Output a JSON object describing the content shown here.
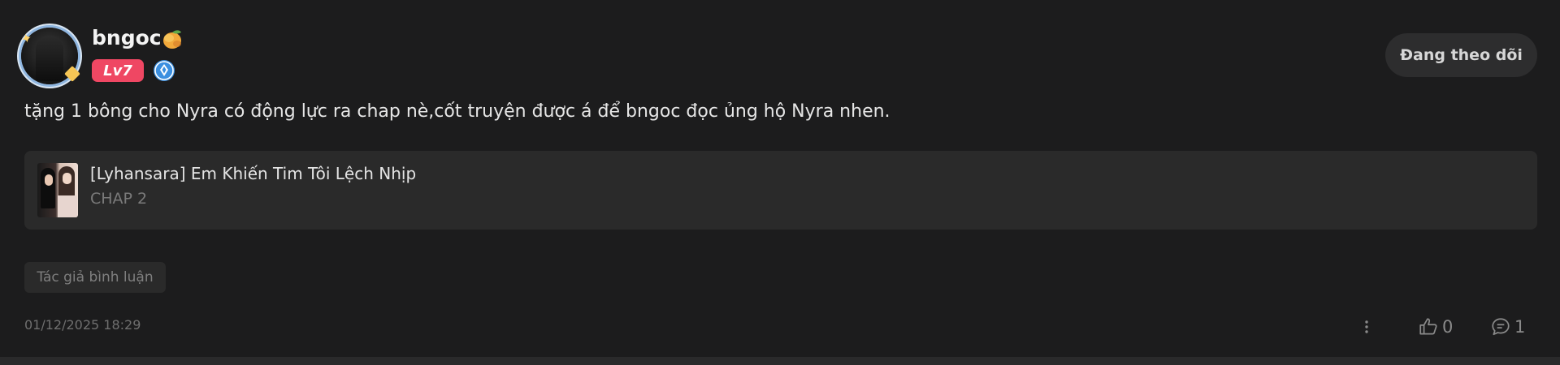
{
  "comment": {
    "author": {
      "username": "bngoc",
      "level": "Lv7",
      "icons": {
        "fruit": "mango-icon",
        "rank": "diamond-rank-icon"
      }
    },
    "follow_label": "Đang theo dõi",
    "text": "tặng 1 bông cho Nyra có động lực ra chap nè,cốt truyện được á để bngoc đọc ủng hộ Nyra nhen.",
    "story": {
      "title": "[Lyhansara] Em Khiến Tim Tôi Lệch Nhịp",
      "chapter": "CHAP 2"
    },
    "author_tag": "Tác giả bình luận",
    "timestamp": "01/12/2025 18:29",
    "likes": "0",
    "replies": "1"
  },
  "colors": {
    "background": "#1c1c1d",
    "level_badge": "#ef4763",
    "card": "#2a2a2a",
    "follow_button": "#2d2d2e"
  }
}
